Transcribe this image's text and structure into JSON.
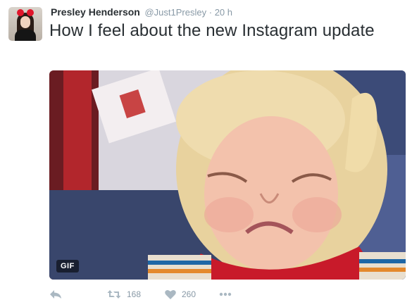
{
  "author": {
    "name": "Presley Henderson",
    "handle": "@Just1Presley",
    "separator": "·",
    "time": "20 h"
  },
  "tweet": {
    "text": "How I feel about the new Instagram update"
  },
  "media": {
    "badge": "GIF"
  },
  "actions": {
    "retweet_count": "168",
    "like_count": "260"
  },
  "icons": {
    "reply": "reply-icon",
    "retweet": "retweet-icon",
    "like": "heart-icon",
    "more": "more-icon"
  },
  "colors": {
    "text": "#292f33",
    "muted": "#8899a6",
    "icon": "#aab8c2"
  }
}
